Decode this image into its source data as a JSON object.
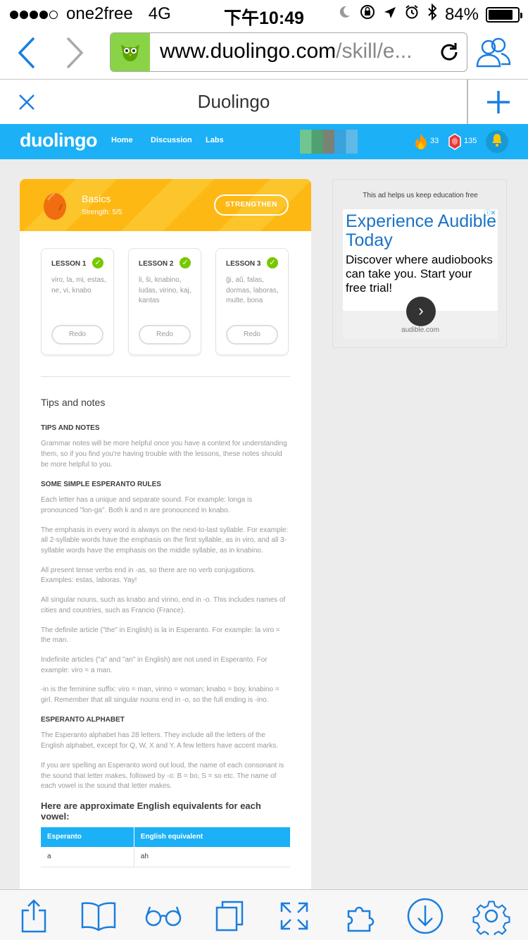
{
  "status_bar": {
    "carrier": "one2free",
    "network": "4G",
    "time": "下午10:49",
    "battery": "84%",
    "battery_level": 0.84
  },
  "browser": {
    "url": "www.duolingo.com/skill/e...",
    "url_host": "www.duolingo.com",
    "url_path": "/skill/e...",
    "tab_title": "Duolingo"
  },
  "duo_nav": {
    "logo": "duolingo",
    "links": [
      "Home",
      "Discussion",
      "Labs"
    ],
    "streak": "33",
    "gems": "135"
  },
  "skill": {
    "name": "Basics",
    "strength": "Strength: 5/5",
    "strengthen_label": "STRENGTHEN",
    "lessons": [
      {
        "title": "LESSON 1",
        "words": "viro, la, mi, estas, ne, vi, knabo",
        "button": "Redo"
      },
      {
        "title": "LESSON 2",
        "words": "li, ŝi, knabino, ludas, virino, kaj, kantas",
        "button": "Redo"
      },
      {
        "title": "LESSON 3",
        "words": "ĝi, aŭ, falas, dormas, laboras, multe, bona",
        "button": "Redo"
      }
    ]
  },
  "tips": {
    "title": "Tips and notes",
    "sections": [
      {
        "heading": "TIPS AND NOTES"
      },
      {
        "heading": "SOME SIMPLE ESPERANTO RULES"
      },
      {
        "heading": "ESPERANTO ALPHABET"
      }
    ],
    "p1": "Grammar notes will be more helpful once you have a context for understanding them, so if you find you're having trouble with the lessons, these notes should be more helpful to you.",
    "p2": "Each letter has a unique and separate sound. For example: longa is pronounced \"lon-ga\". Both k and n are pronounced in knabo.",
    "p3": "The emphasis in every word is always on the next-to-last syllable. For example: all 2-syllable words have the emphasis on the first syllable, as in viro, and all 3-syllable words have the emphasis on the middle syllable, as in knabino.",
    "p4": "All present tense verbs end in -as, so there are no verb conjugations. Examples: estas, laboras. Yay!",
    "p5": "All singular nouns, such as knabo and virino, end in -o. This includes names of cities and countries, such as Francio (France).",
    "p6": "The definite article (\"the\" in English) is la in Esperanto. For example: la viro = the man.",
    "p7": "Indefinite articles (\"a\" and \"an\" in English) are not used in Esperanto. For example: viro = a man.",
    "p8": "-in is the feminine suffix: viro = man, virino = woman; knabo = boy, knabino = girl. Remember that all singular nouns end in -o, so the full ending is -ino.",
    "p9": "The Esperanto alphabet has 28 letters. They include all the letters of the English alphabet, except for Q, W, X and Y. A few letters have accent marks.",
    "p10": "If you are spelling an Esperanto word out loud, the name of each consonant is the sound that letter makes, followed by -o: B = bo, S = so etc. The name of each vowel is the sound that letter makes.",
    "vowel_heading": "Here are approximate English equivalents for each vowel:",
    "table": {
      "headers": [
        "Esperanto",
        "English equivalent"
      ],
      "rows": [
        [
          "a",
          "ah"
        ]
      ]
    }
  },
  "ad": {
    "label": "This ad helps us keep education free",
    "headline": "Experience Audible Today",
    "body": "Discover where audiobooks can take you. Start your free trial!",
    "domain": "audible.com"
  },
  "colors": {
    "duo_blue": "#1cb0f6",
    "skill_gold": "#fdb813",
    "ios_blue": "#1a7ee0",
    "check_green": "#78c800"
  },
  "icons": {
    "toolbar": [
      "share-icon",
      "book-icon",
      "glasses-icon",
      "tabs-icon",
      "fullscreen-icon",
      "extension-icon",
      "download-icon",
      "settings-icon"
    ]
  }
}
